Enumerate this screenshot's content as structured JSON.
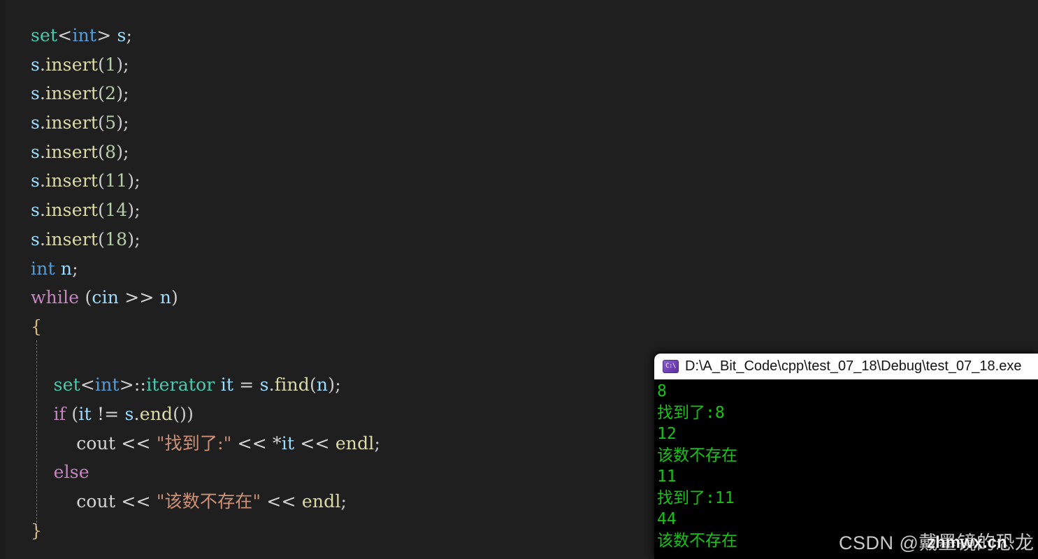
{
  "editor": {
    "background": "#1f1f1f",
    "language": "cpp",
    "lines": [
      [
        {
          "t": "set",
          "c": "t-type"
        },
        {
          "t": "<",
          "c": "t-punc"
        },
        {
          "t": "int",
          "c": "t-kw"
        },
        {
          "t": ">",
          "c": "t-punc"
        },
        {
          "t": " ",
          "c": "t-plain"
        },
        {
          "t": "s",
          "c": "t-var"
        },
        {
          "t": ";",
          "c": "t-punc"
        }
      ],
      [
        {
          "t": "s",
          "c": "t-var"
        },
        {
          "t": ".",
          "c": "t-punc"
        },
        {
          "t": "insert",
          "c": "t-fn"
        },
        {
          "t": "(",
          "c": "t-punc"
        },
        {
          "t": "1",
          "c": "t-num"
        },
        {
          "t": ")",
          "c": "t-punc"
        },
        {
          "t": ";",
          "c": "t-punc"
        }
      ],
      [
        {
          "t": "s",
          "c": "t-var"
        },
        {
          "t": ".",
          "c": "t-punc"
        },
        {
          "t": "insert",
          "c": "t-fn"
        },
        {
          "t": "(",
          "c": "t-punc"
        },
        {
          "t": "2",
          "c": "t-num"
        },
        {
          "t": ")",
          "c": "t-punc"
        },
        {
          "t": ";",
          "c": "t-punc"
        }
      ],
      [
        {
          "t": "s",
          "c": "t-var"
        },
        {
          "t": ".",
          "c": "t-punc"
        },
        {
          "t": "insert",
          "c": "t-fn"
        },
        {
          "t": "(",
          "c": "t-punc"
        },
        {
          "t": "5",
          "c": "t-num"
        },
        {
          "t": ")",
          "c": "t-punc"
        },
        {
          "t": ";",
          "c": "t-punc"
        }
      ],
      [
        {
          "t": "s",
          "c": "t-var"
        },
        {
          "t": ".",
          "c": "t-punc"
        },
        {
          "t": "insert",
          "c": "t-fn"
        },
        {
          "t": "(",
          "c": "t-punc"
        },
        {
          "t": "8",
          "c": "t-num"
        },
        {
          "t": ")",
          "c": "t-punc"
        },
        {
          "t": ";",
          "c": "t-punc"
        }
      ],
      [
        {
          "t": "s",
          "c": "t-var"
        },
        {
          "t": ".",
          "c": "t-punc"
        },
        {
          "t": "insert",
          "c": "t-fn"
        },
        {
          "t": "(",
          "c": "t-punc"
        },
        {
          "t": "11",
          "c": "t-num"
        },
        {
          "t": ")",
          "c": "t-punc"
        },
        {
          "t": ";",
          "c": "t-punc"
        }
      ],
      [
        {
          "t": "s",
          "c": "t-var"
        },
        {
          "t": ".",
          "c": "t-punc"
        },
        {
          "t": "insert",
          "c": "t-fn"
        },
        {
          "t": "(",
          "c": "t-punc"
        },
        {
          "t": "14",
          "c": "t-num"
        },
        {
          "t": ")",
          "c": "t-punc"
        },
        {
          "t": ";",
          "c": "t-punc"
        }
      ],
      [
        {
          "t": "s",
          "c": "t-var"
        },
        {
          "t": ".",
          "c": "t-punc"
        },
        {
          "t": "insert",
          "c": "t-fn"
        },
        {
          "t": "(",
          "c": "t-punc"
        },
        {
          "t": "18",
          "c": "t-num"
        },
        {
          "t": ")",
          "c": "t-punc"
        },
        {
          "t": ";",
          "c": "t-punc"
        }
      ],
      [
        {
          "t": "int",
          "c": "t-kw"
        },
        {
          "t": " ",
          "c": "t-plain"
        },
        {
          "t": "n",
          "c": "t-var"
        },
        {
          "t": ";",
          "c": "t-punc"
        }
      ],
      [
        {
          "t": "while",
          "c": "t-ctl"
        },
        {
          "t": " (",
          "c": "t-punc"
        },
        {
          "t": "cin",
          "c": "t-var"
        },
        {
          "t": " ",
          "c": "t-plain"
        },
        {
          "t": ">>",
          "c": "t-op"
        },
        {
          "t": " ",
          "c": "t-plain"
        },
        {
          "t": "n",
          "c": "t-var"
        },
        {
          "t": ")",
          "c": "t-punc"
        }
      ],
      [
        {
          "t": "{",
          "c": "t-brace"
        }
      ],
      [
        {
          "t": "",
          "c": "t-plain"
        }
      ],
      [
        {
          "t": "    ",
          "c": "t-plain"
        },
        {
          "t": "set",
          "c": "t-type"
        },
        {
          "t": "<",
          "c": "t-punc"
        },
        {
          "t": "int",
          "c": "t-kw"
        },
        {
          "t": ">::",
          "c": "t-punc"
        },
        {
          "t": "iterator",
          "c": "t-type"
        },
        {
          "t": " ",
          "c": "t-plain"
        },
        {
          "t": "it",
          "c": "t-var"
        },
        {
          "t": " ",
          "c": "t-plain"
        },
        {
          "t": "=",
          "c": "t-op"
        },
        {
          "t": " ",
          "c": "t-plain"
        },
        {
          "t": "s",
          "c": "t-var"
        },
        {
          "t": ".",
          "c": "t-punc"
        },
        {
          "t": "find",
          "c": "t-fn"
        },
        {
          "t": "(",
          "c": "t-punc"
        },
        {
          "t": "n",
          "c": "t-var"
        },
        {
          "t": ")",
          "c": "t-punc"
        },
        {
          "t": ";",
          "c": "t-punc"
        }
      ],
      [
        {
          "t": "    ",
          "c": "t-plain"
        },
        {
          "t": "if",
          "c": "t-ctl"
        },
        {
          "t": " (",
          "c": "t-punc"
        },
        {
          "t": "it",
          "c": "t-var"
        },
        {
          "t": " ",
          "c": "t-plain"
        },
        {
          "t": "!=",
          "c": "t-op"
        },
        {
          "t": " ",
          "c": "t-plain"
        },
        {
          "t": "s",
          "c": "t-var"
        },
        {
          "t": ".",
          "c": "t-punc"
        },
        {
          "t": "end",
          "c": "t-fn"
        },
        {
          "t": "())",
          "c": "t-punc"
        }
      ],
      [
        {
          "t": "        ",
          "c": "t-plain"
        },
        {
          "t": "cout",
          "c": "t-plain"
        },
        {
          "t": " ",
          "c": "t-plain"
        },
        {
          "t": "<<",
          "c": "t-op"
        },
        {
          "t": " ",
          "c": "t-plain"
        },
        {
          "t": "\"找到了:\"",
          "c": "t-str"
        },
        {
          "t": " ",
          "c": "t-plain"
        },
        {
          "t": "<<",
          "c": "t-op"
        },
        {
          "t": " ",
          "c": "t-plain"
        },
        {
          "t": "*",
          "c": "t-op"
        },
        {
          "t": "it",
          "c": "t-var"
        },
        {
          "t": " ",
          "c": "t-plain"
        },
        {
          "t": "<<",
          "c": "t-op"
        },
        {
          "t": " ",
          "c": "t-plain"
        },
        {
          "t": "endl",
          "c": "t-fn"
        },
        {
          "t": ";",
          "c": "t-punc"
        }
      ],
      [
        {
          "t": "    ",
          "c": "t-plain"
        },
        {
          "t": "else",
          "c": "t-ctl"
        }
      ],
      [
        {
          "t": "        ",
          "c": "t-plain"
        },
        {
          "t": "cout",
          "c": "t-plain"
        },
        {
          "t": " ",
          "c": "t-plain"
        },
        {
          "t": "<<",
          "c": "t-op"
        },
        {
          "t": " ",
          "c": "t-plain"
        },
        {
          "t": "\"该数不存在\"",
          "c": "t-str"
        },
        {
          "t": " ",
          "c": "t-plain"
        },
        {
          "t": "<<",
          "c": "t-op"
        },
        {
          "t": " ",
          "c": "t-plain"
        },
        {
          "t": "endl",
          "c": "t-fn"
        },
        {
          "t": ";",
          "c": "t-punc"
        }
      ],
      [
        {
          "t": "}",
          "c": "t-brace"
        }
      ]
    ]
  },
  "console": {
    "icon": "console-app-icon",
    "icon_glyph": "C:\\",
    "title": "D:\\A_Bit_Code\\cpp\\test_07_18\\Debug\\test_07_18.exe",
    "text_color": "#15c415",
    "background": "#000000",
    "output_lines": [
      "8",
      "找到了:8",
      "12",
      "该数不存在",
      "11",
      "找到了:11",
      "44",
      "该数不存在"
    ]
  },
  "watermarks": {
    "csdn": "CSDN @戴墨镜的恐龙",
    "site": "zhmwx.cn"
  }
}
